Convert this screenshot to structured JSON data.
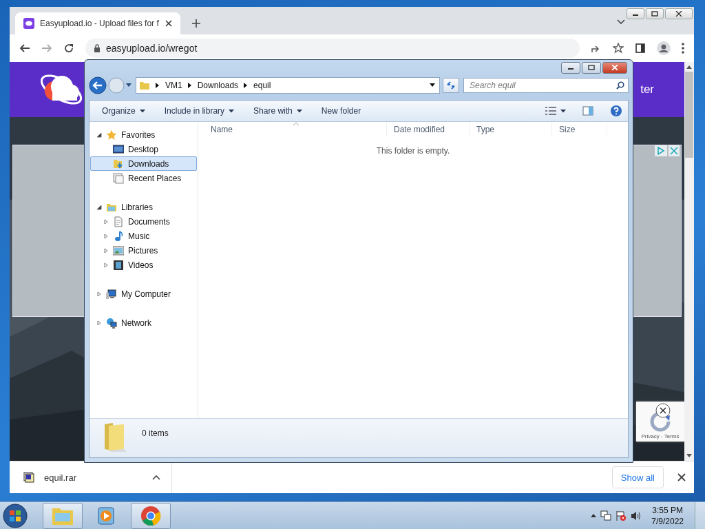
{
  "browser": {
    "tabs": [
      {
        "title": "Easyupload.io - Upload files for f",
        "selected": true
      }
    ],
    "address": "easyupload.io/wregot",
    "page": {
      "header_link": "ter",
      "recaptcha": "Privacy - Terms"
    },
    "downloads": [
      {
        "name": "equil.rar"
      }
    ],
    "show_all": "Show all"
  },
  "explorer": {
    "breadcrumb": [
      "VM1",
      "Downloads",
      "equil"
    ],
    "search_placeholder": "Search equil",
    "commands": [
      {
        "label": "Organize",
        "dropdown": true
      },
      {
        "label": "Include in library",
        "dropdown": true
      },
      {
        "label": "Share with",
        "dropdown": true
      },
      {
        "label": "New folder",
        "dropdown": false
      }
    ],
    "nav": [
      {
        "label": "Favorites",
        "kind": "star",
        "expanded": true,
        "children": [
          {
            "label": "Desktop",
            "kind": "desktop",
            "selected": false
          },
          {
            "label": "Downloads",
            "kind": "downloads",
            "selected": true
          },
          {
            "label": "Recent Places",
            "kind": "recent",
            "selected": false
          }
        ]
      },
      {
        "label": "Libraries",
        "kind": "library",
        "expanded": true,
        "children": [
          {
            "label": "Documents",
            "kind": "documents",
            "expanded": false,
            "selected": false
          },
          {
            "label": "Music",
            "kind": "music",
            "expanded": false,
            "selected": false
          },
          {
            "label": "Pictures",
            "kind": "pictures",
            "expanded": false,
            "selected": false
          },
          {
            "label": "Videos",
            "kind": "videos",
            "expanded": false,
            "selected": false
          }
        ]
      },
      {
        "label": "My Computer",
        "kind": "computer",
        "expanded": false
      },
      {
        "label": "Network",
        "kind": "network",
        "expanded": false
      }
    ],
    "columns": [
      "Name",
      "Date modified",
      "Type",
      "Size"
    ],
    "empty_message": "This folder is empty.",
    "status": "0 items"
  },
  "taskbar": {
    "apps": [
      {
        "kind": "explorer",
        "active": true
      },
      {
        "kind": "media",
        "active": false
      },
      {
        "kind": "chrome",
        "active": true
      }
    ],
    "time": "3:55 PM",
    "date": "7/9/2022"
  }
}
